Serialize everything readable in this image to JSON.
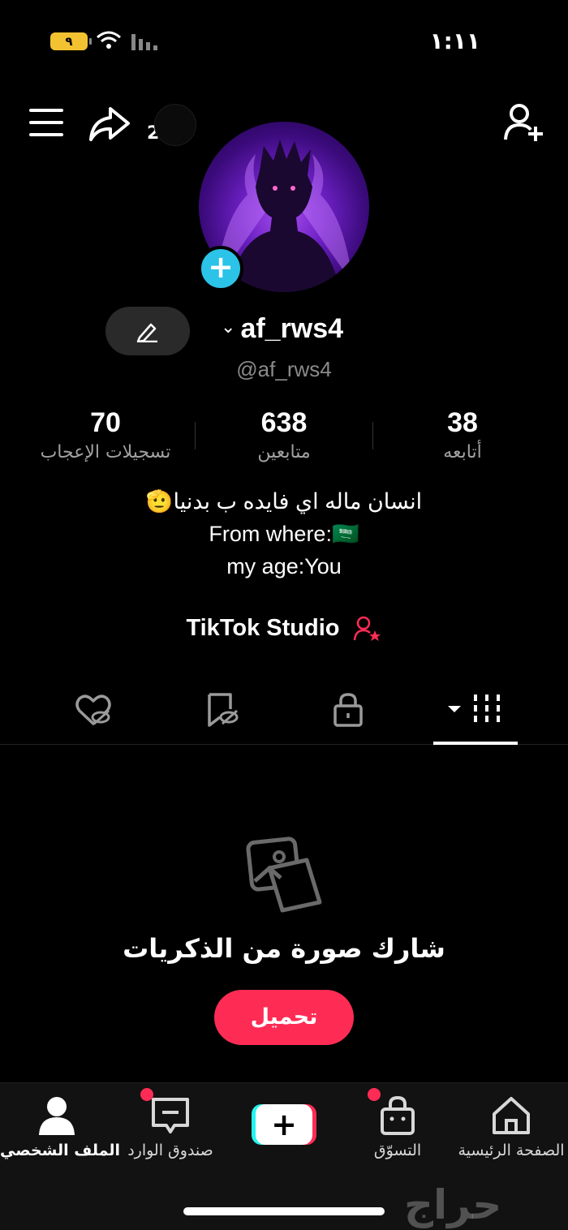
{
  "status_bar": {
    "time": "١:١١",
    "battery": "٩"
  },
  "header": {
    "share_count": "2"
  },
  "profile": {
    "username": "af_rws4",
    "handle": "@af_rws4",
    "stats": [
      {
        "value": "38",
        "label": "أتابعه"
      },
      {
        "value": "638",
        "label": "متابعين"
      },
      {
        "value": "70",
        "label": "تسجيلات الإعجاب"
      }
    ],
    "bio": [
      "انسان ماله اي فايده ب بدنيا🫡",
      "From where:🇸🇦",
      "my age:You"
    ],
    "studio": "TikTok Studio"
  },
  "tabs": [
    {
      "name": "videos",
      "icon": "grid-icon",
      "active": true
    },
    {
      "name": "private",
      "icon": "lock-icon"
    },
    {
      "name": "favorites",
      "icon": "bookmark-hidden-icon"
    },
    {
      "name": "liked",
      "icon": "heart-hidden-icon"
    }
  ],
  "empty_state": {
    "title": "شارك صورة من الذكريات",
    "button": "تحميل"
  },
  "bottom_nav": {
    "home": "الصفحة الرئيسية",
    "shop": "التسوّق",
    "inbox": "صندوق الوارد",
    "profile": "الملف الشخصي"
  },
  "watermark": "حراج",
  "colors": {
    "accent": "#fe2c55",
    "cyan": "#25f4ee",
    "plus_badge": "#2bc3e8"
  }
}
